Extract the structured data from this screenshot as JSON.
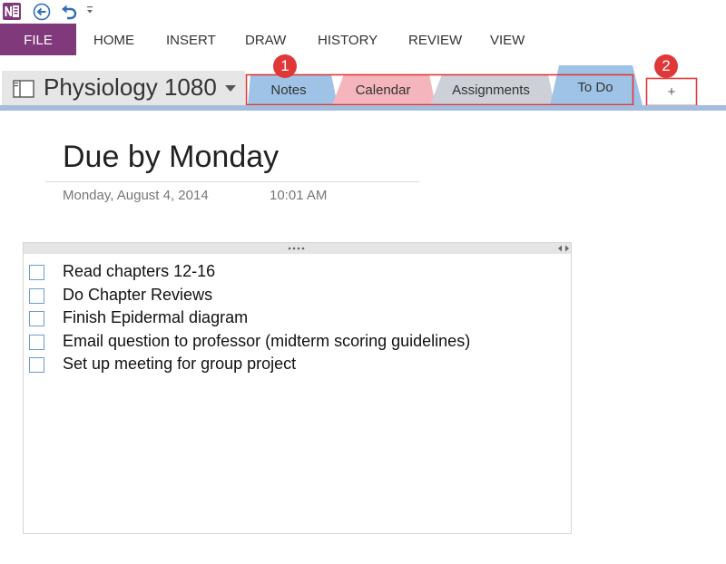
{
  "quick_access": {
    "icons": [
      "onenote-app-icon",
      "back-arrow-icon",
      "undo-icon",
      "customize-dropdown-icon"
    ]
  },
  "ribbon": {
    "tabs": [
      "FILE",
      "HOME",
      "INSERT",
      "DRAW",
      "HISTORY",
      "REVIEW",
      "VIEW"
    ]
  },
  "notebook": {
    "name": "Physiology 1080"
  },
  "sections": [
    {
      "label": "Notes",
      "color": "#9fc3e7"
    },
    {
      "label": "Calendar",
      "color": "#f4b6bc"
    },
    {
      "label": "Assignments",
      "color": "#cdd0d7"
    },
    {
      "label": "To Do",
      "color": "#9fc3e7",
      "active": true
    }
  ],
  "add_section": {
    "label": "+"
  },
  "badges": [
    "1",
    "2"
  ],
  "colors": {
    "file_tab": "#80397b",
    "callout_red": "#e03838",
    "checkbox_border": "#6b9bd0",
    "section_strip": "#a3bddf"
  },
  "page": {
    "title": "Due by Monday",
    "date": "Monday, August 4, 2014",
    "time": "10:01 AM"
  },
  "todo_items": [
    "Read chapters 12-16",
    "Do Chapter Reviews",
    "Finish Epidermal diagram",
    "Email question to professor (midterm scoring guidelines)",
    "Set up meeting for group project"
  ]
}
